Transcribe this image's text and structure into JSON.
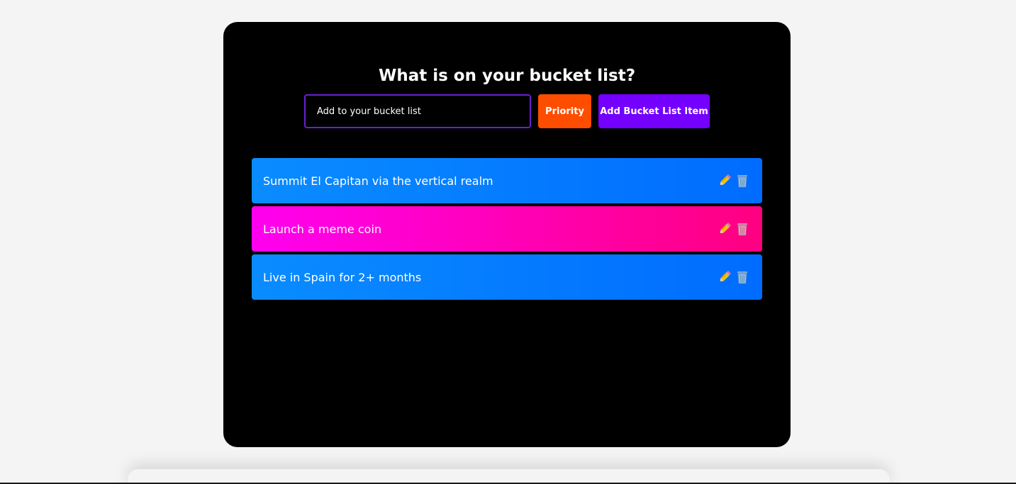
{
  "app": {
    "title": "What is on your bucket list?"
  },
  "form": {
    "input_placeholder": "Add to your bucket list",
    "input_value": "",
    "priority_label": "Priority",
    "add_label": "Add Bucket List Item"
  },
  "colors": {
    "input_border": "#6a1fd1",
    "priority_button": "#ff4d00",
    "add_button": "#7400ff",
    "row_blue": [
      "#0a8cff",
      "#006cff"
    ],
    "row_pink": [
      "#ff00f0",
      "#ff0080"
    ]
  },
  "items": [
    {
      "label": "Summit El Capitan via the vertical realm",
      "variant": "blue",
      "edit_icon": "pencil-icon",
      "delete_icon": "trash-icon"
    },
    {
      "label": "Launch a meme coin",
      "variant": "pink",
      "edit_icon": "pencil-icon",
      "delete_icon": "trash-icon"
    },
    {
      "label": "Live in Spain for 2+ months",
      "variant": "blue",
      "edit_icon": "pencil-icon",
      "delete_icon": "trash-icon"
    }
  ]
}
